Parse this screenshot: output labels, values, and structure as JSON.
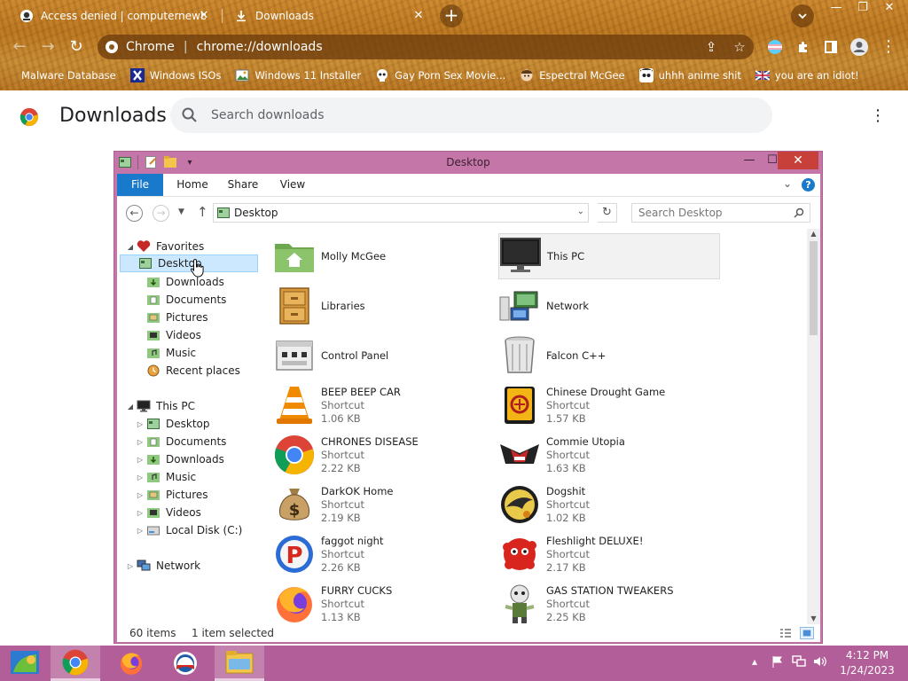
{
  "browser": {
    "tabs": [
      {
        "title": "Access denied | computernewb.co",
        "active": false
      },
      {
        "title": "Downloads",
        "active": true
      }
    ],
    "omnibox": {
      "site": "Chrome",
      "url": "chrome://downloads"
    },
    "bookmarks": [
      "Malware Database",
      "Windows ISOs",
      "Windows 11 Installer",
      "Gay Porn Sex Movie...",
      "Espectral McGee",
      "uhhh anime shit",
      "you are an idiot!"
    ],
    "accent": "#c9852e"
  },
  "downloads_page": {
    "title": "Downloads",
    "search_placeholder": "Search downloads"
  },
  "explorer": {
    "window_title": "Desktop",
    "ribbon_tabs": [
      "File",
      "Home",
      "Share",
      "View"
    ],
    "address": "Desktop",
    "search_placeholder": "Search Desktop",
    "nav": {
      "favorites_label": "Favorites",
      "favorites": [
        "Desktop",
        "Downloads",
        "Documents",
        "Pictures",
        "Videos",
        "Music",
        "Recent places"
      ],
      "thispc_label": "This PC",
      "thispc": [
        "Desktop",
        "Documents",
        "Downloads",
        "Music",
        "Pictures",
        "Videos",
        "Local Disk (C:)"
      ],
      "network_label": "Network"
    },
    "items": [
      {
        "name": "Molly McGee",
        "type": "",
        "size": "",
        "icon": "home-folder-icon"
      },
      {
        "name": "This PC",
        "type": "",
        "size": "",
        "icon": "monitor-icon"
      },
      {
        "name": "Libraries",
        "type": "",
        "size": "",
        "icon": "libraries-icon"
      },
      {
        "name": "Network",
        "type": "",
        "size": "",
        "icon": "network-icon"
      },
      {
        "name": "Control Panel",
        "type": "",
        "size": "",
        "icon": "control-panel-icon"
      },
      {
        "name": "Falcon C++",
        "type": "",
        "size": "",
        "icon": "recycle-bin-icon"
      },
      {
        "name": "BEEP BEEP CAR",
        "type": "Shortcut",
        "size": "1.06 KB",
        "icon": "vlc-cone-icon"
      },
      {
        "name": "Chinese Drought Game",
        "type": "Shortcut",
        "size": "1.57 KB",
        "icon": "mahjong-tile-icon"
      },
      {
        "name": "CHRONES DISEASE",
        "type": "Shortcut",
        "size": "2.22 KB",
        "icon": "chrome-icon"
      },
      {
        "name": "Commie Utopia",
        "type": "Shortcut",
        "size": "1.63 KB",
        "icon": "eagle-emblem-icon"
      },
      {
        "name": "DarkOK Home",
        "type": "Shortcut",
        "size": "2.19 KB",
        "icon": "money-bag-icon"
      },
      {
        "name": "Dogshit",
        "type": "Shortcut",
        "size": "1.02 KB",
        "icon": "bird-badge-icon"
      },
      {
        "name": "faggot night",
        "type": "Shortcut",
        "size": "2.26 KB",
        "icon": "p-badge-icon"
      },
      {
        "name": "Fleshlight DELUXE!",
        "type": "Shortcut",
        "size": "2.17 KB",
        "icon": "red-fuzzball-icon"
      },
      {
        "name": "FURRY CUCKS",
        "type": "Shortcut",
        "size": "1.13 KB",
        "icon": "firefox-icon"
      },
      {
        "name": "GAS STATION TWEAKERS",
        "type": "Shortcut",
        "size": "2.25 KB",
        "icon": "zombie-icon"
      }
    ],
    "status": {
      "count": "60 items",
      "selected": "1 item selected"
    },
    "accent": "#c576a8"
  },
  "taskbar": {
    "clock_time": "4:12 PM",
    "clock_date": "1/24/2023",
    "color": "#b25e98"
  }
}
